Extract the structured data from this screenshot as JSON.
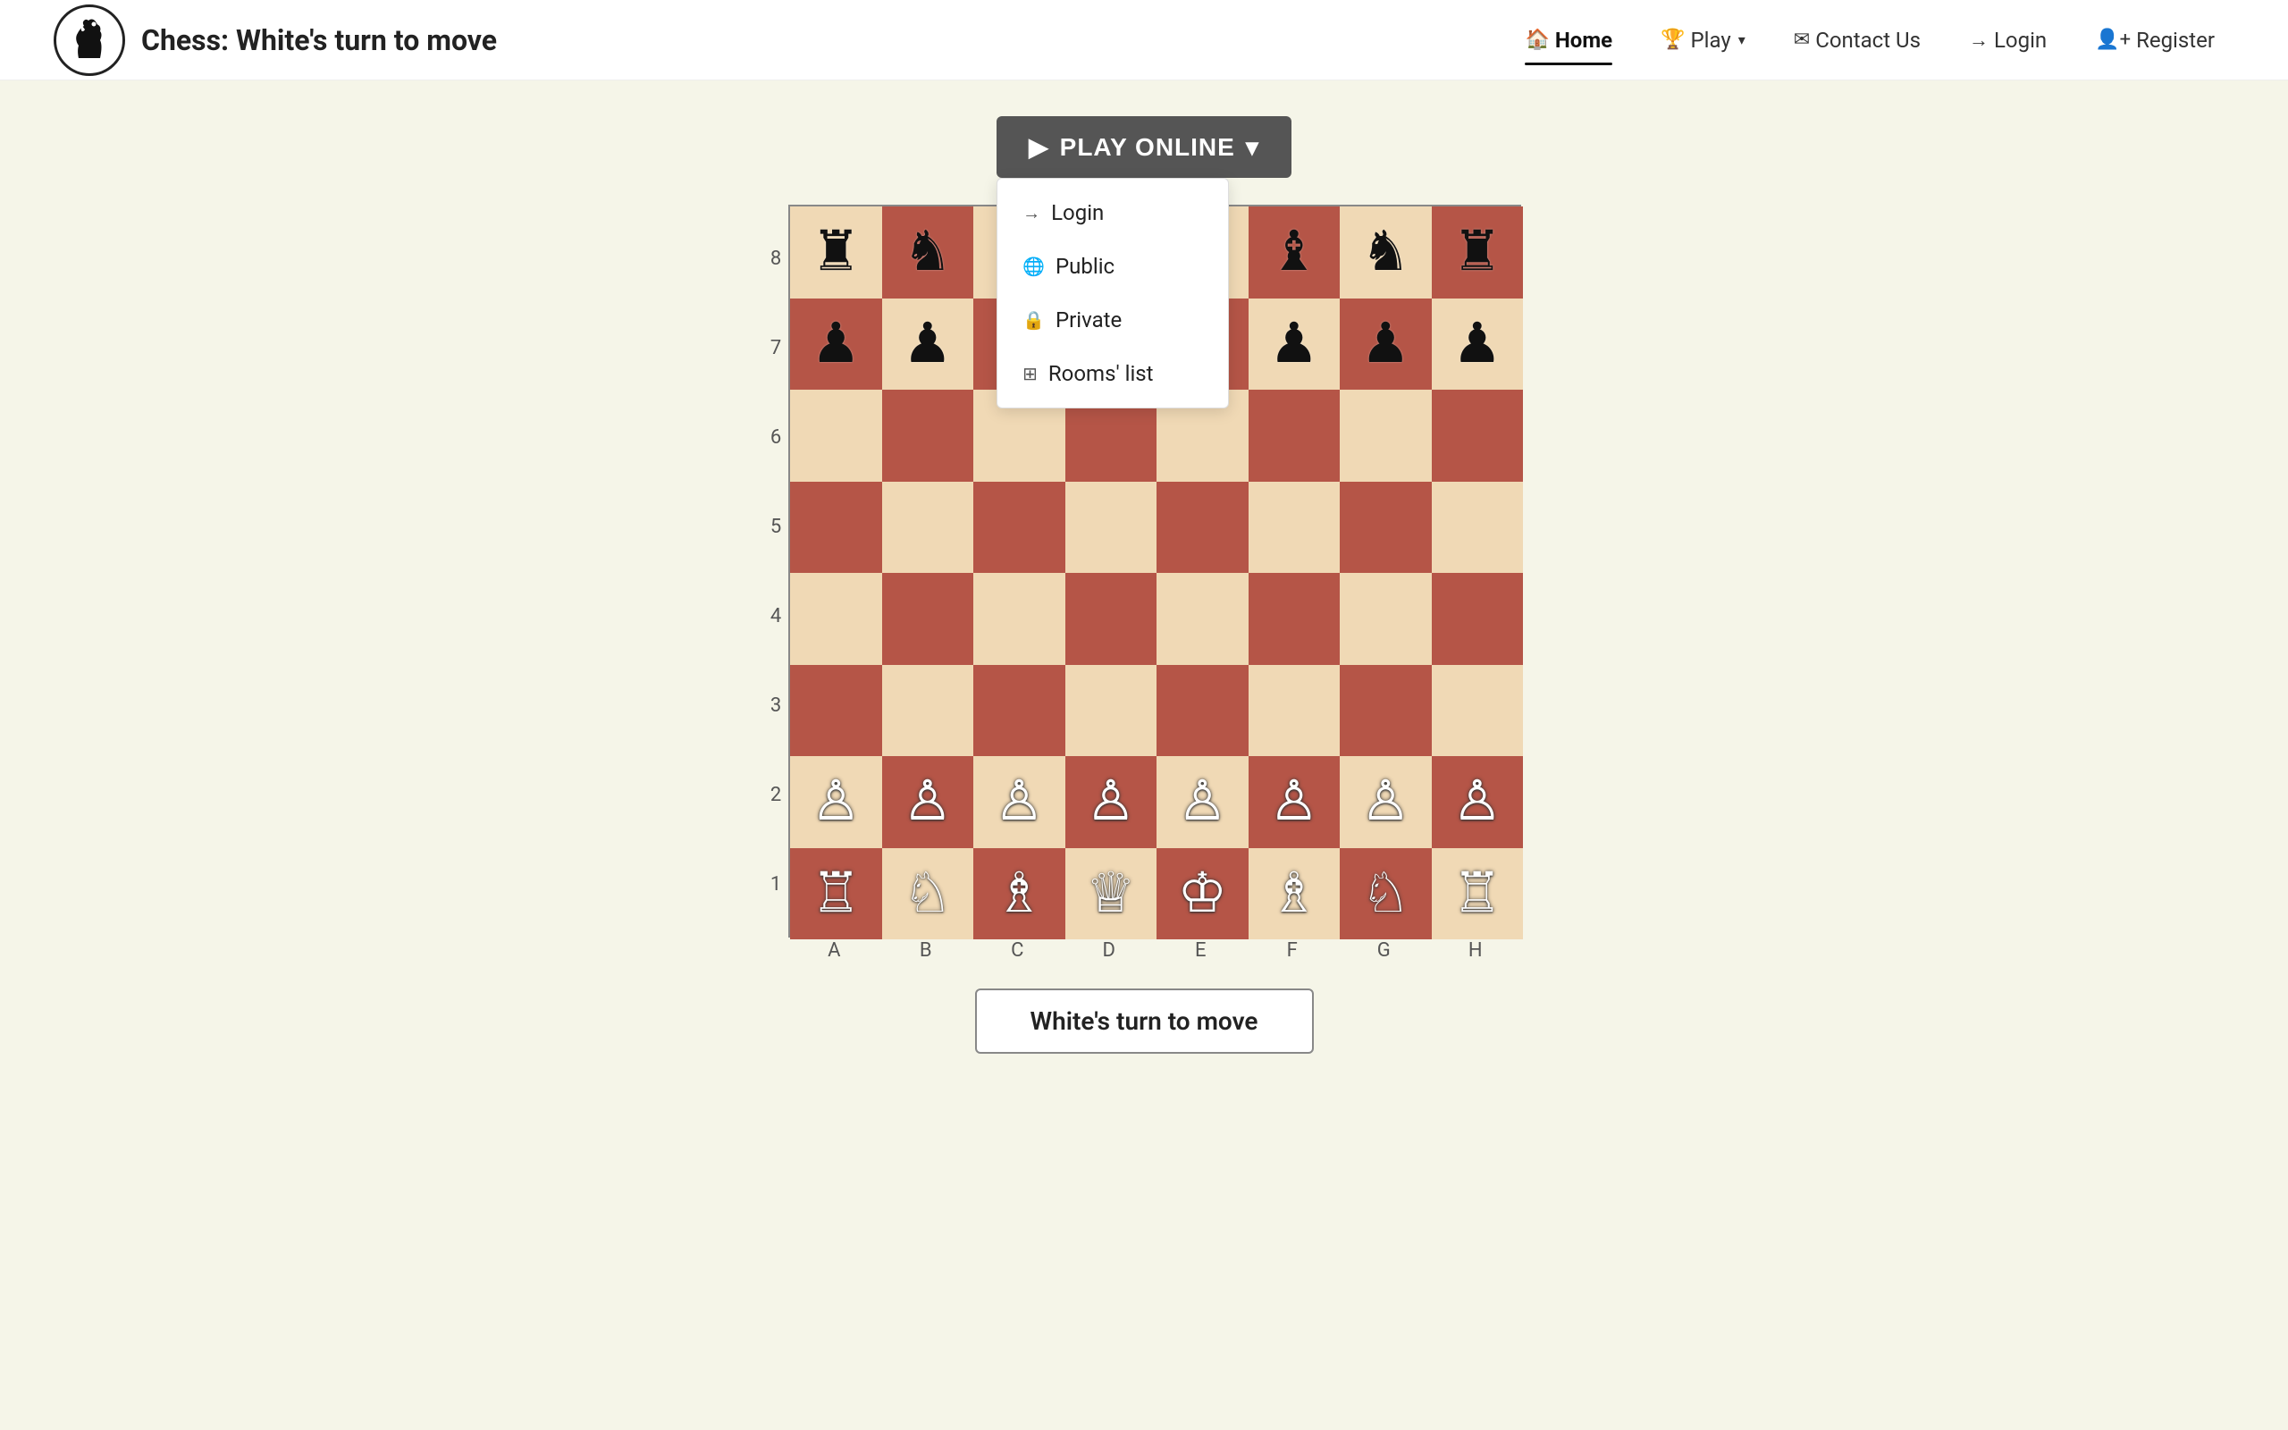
{
  "brand": {
    "title_bold": "Chess:",
    "title_rest": " White's turn to move"
  },
  "navbar": {
    "home_label": "Home",
    "play_label": "Play",
    "contact_label": "Contact Us",
    "login_label": "Login",
    "register_label": "Register"
  },
  "play_online": {
    "button_label": "PLAY ONLINE",
    "dropdown": {
      "login": "Login",
      "public": "Public",
      "private": "Private",
      "rooms_list": "Rooms' list"
    }
  },
  "board": {
    "rank_labels": [
      "8",
      "7",
      "6",
      "5",
      "4",
      "3",
      "2",
      "1"
    ],
    "file_labels": [
      "A",
      "B",
      "C",
      "D",
      "E",
      "F",
      "G",
      "H"
    ]
  },
  "status": {
    "text": "White's turn to move"
  },
  "colors": {
    "light_square": "#f0d9b5",
    "dark_square": "#b55547",
    "navbar_bg": "#ffffff",
    "body_bg": "#f5f5e8",
    "btn_bg": "#555555"
  }
}
